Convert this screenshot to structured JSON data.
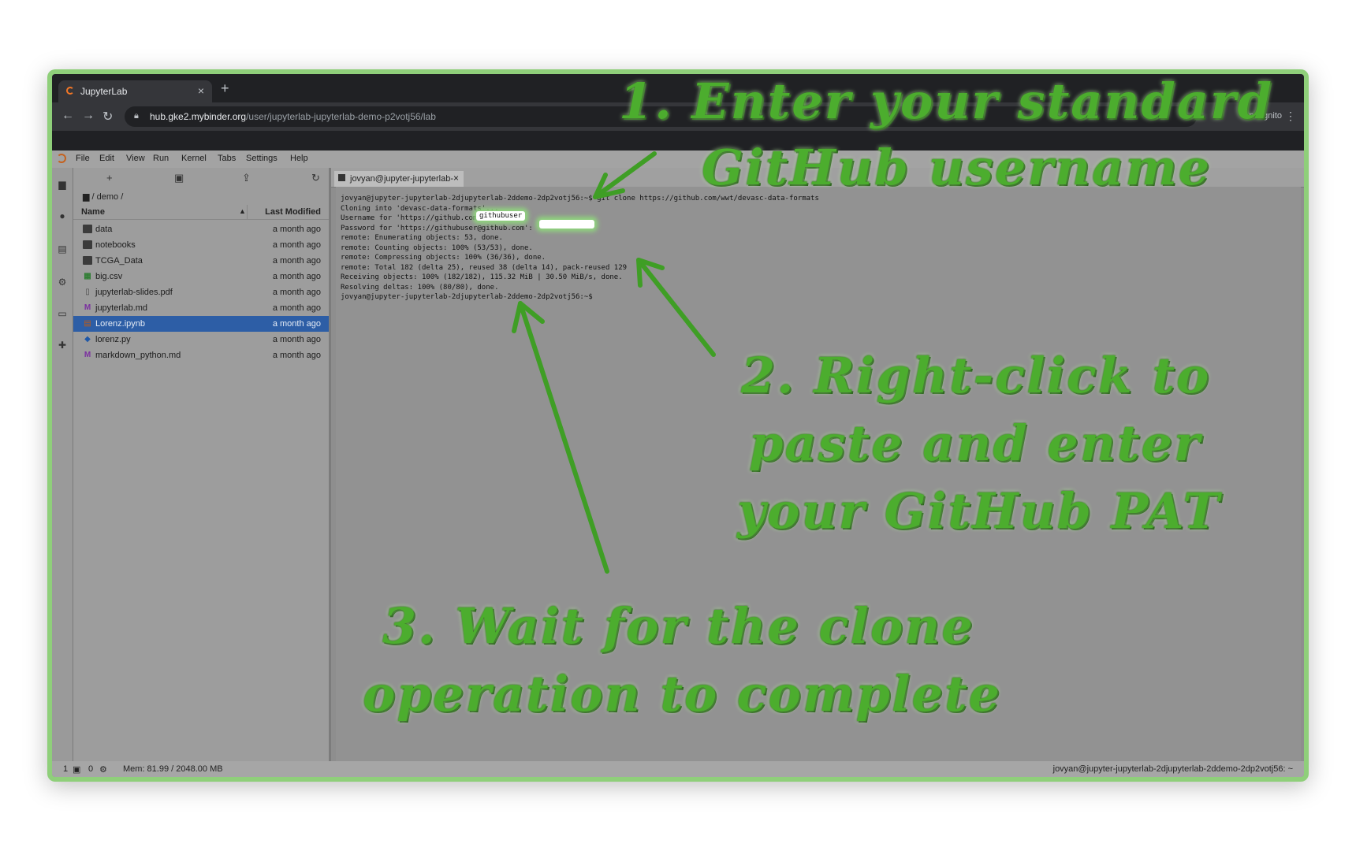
{
  "browser": {
    "tab_title": "JupyterLab",
    "url_host": "hub.gke2.mybinder.org",
    "url_path": "/user/jupyterlab-jupyterlab-demo-p2votj56/lab",
    "incognito_label": "Incognito"
  },
  "menubar": {
    "items": [
      "File",
      "Edit",
      "View",
      "Run",
      "Kernel",
      "Tabs",
      "Settings",
      "Help"
    ]
  },
  "filebrowser": {
    "breadcrumb": "/ demo /",
    "col_name": "Name",
    "col_modified": "Last Modified",
    "rows": [
      {
        "name": "data",
        "modified": "a month ago",
        "icon": "folder-icon"
      },
      {
        "name": "notebooks",
        "modified": "a month ago",
        "icon": "folder-icon"
      },
      {
        "name": "TCGA_Data",
        "modified": "a month ago",
        "icon": "folder-icon"
      },
      {
        "name": "big.csv",
        "modified": "a month ago",
        "icon": "spreadsheet-icon"
      },
      {
        "name": "jupyterlab-slides.pdf",
        "modified": "a month ago",
        "icon": "pdf-file-icon"
      },
      {
        "name": "jupyterlab.md",
        "modified": "a month ago",
        "icon": "markdown-icon"
      },
      {
        "name": "Lorenz.ipynb",
        "modified": "a month ago",
        "icon": "notebook-icon",
        "selected": true
      },
      {
        "name": "lorenz.py",
        "modified": "a month ago",
        "icon": "python-icon"
      },
      {
        "name": "markdown_python.md",
        "modified": "a month ago",
        "icon": "markdown-icon"
      }
    ]
  },
  "terminal": {
    "tab_title": "jovyan@jupyter-jupyterlab-",
    "lines": [
      "jovyan@jupyter-jupyterlab-2djupyterlab-2ddemo-2dp2votj56:~$ git clone https://github.com/wwt/devasc-data-formats",
      "Cloning into 'devasc-data-formats'...",
      "Username for 'https://github.com':",
      "Password for 'https://githubuser@github.com':",
      "remote: Enumerating objects: 53, done.",
      "remote: Counting objects: 100% (53/53), done.",
      "remote: Compressing objects: 100% (36/36), done.",
      "remote: Total 182 (delta 25), reused 38 (delta 14), pack-reused 129",
      "Receiving objects: 100% (182/182), 115.32 MiB | 30.50 MiB/s, done.",
      "Resolving deltas: 100% (80/80), done.",
      "jovyan@jupyter-jupyterlab-2djupyterlab-2ddemo-2dp2votj56:~$"
    ],
    "username_value": "githubuser"
  },
  "statusbar": {
    "terminals_count": "1",
    "kernels_count": "0",
    "memory": "Mem: 81.99 / 2048.00 MB",
    "right_text": "jovyan@jupyter-jupyterlab-2djupyterlab-2ddemo-2dp2votj56: ~"
  },
  "annotations": {
    "step1_line1": "1. Enter your standard",
    "step1_line2": "GitHub username",
    "step2_line1": "2. Right-click to",
    "step2_line2": "paste and enter",
    "step2_line3": "your GitHub PAT",
    "step3_line1": "3. Wait for the clone",
    "step3_line2": "operation to complete",
    "color": "#4cad2e"
  }
}
